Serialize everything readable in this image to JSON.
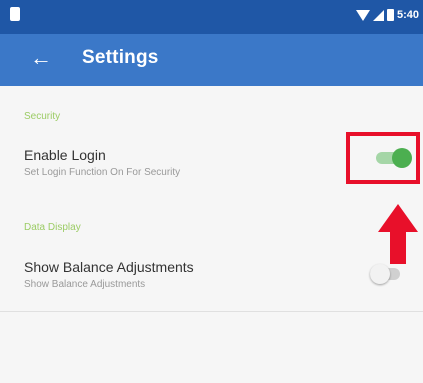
{
  "status_bar": {
    "time": "5:40"
  },
  "app_bar": {
    "back_icon": "arrow-left-icon",
    "title": "Settings"
  },
  "sections": [
    {
      "header": "Security",
      "settings": [
        {
          "title": "Enable Login",
          "subtitle": "Set Login Function On For Security",
          "enabled": true
        }
      ]
    },
    {
      "header": "Data Display",
      "settings": [
        {
          "title": "Show Balance Adjustments",
          "subtitle": "Show Balance Adjustments",
          "enabled": false
        }
      ]
    }
  ],
  "colors": {
    "status_bar": "#1f57a6",
    "app_bar": "#3b78c8",
    "section_header": "#9ccc65",
    "toggle_on": "#4caf50",
    "annotation": "#e8102a"
  }
}
